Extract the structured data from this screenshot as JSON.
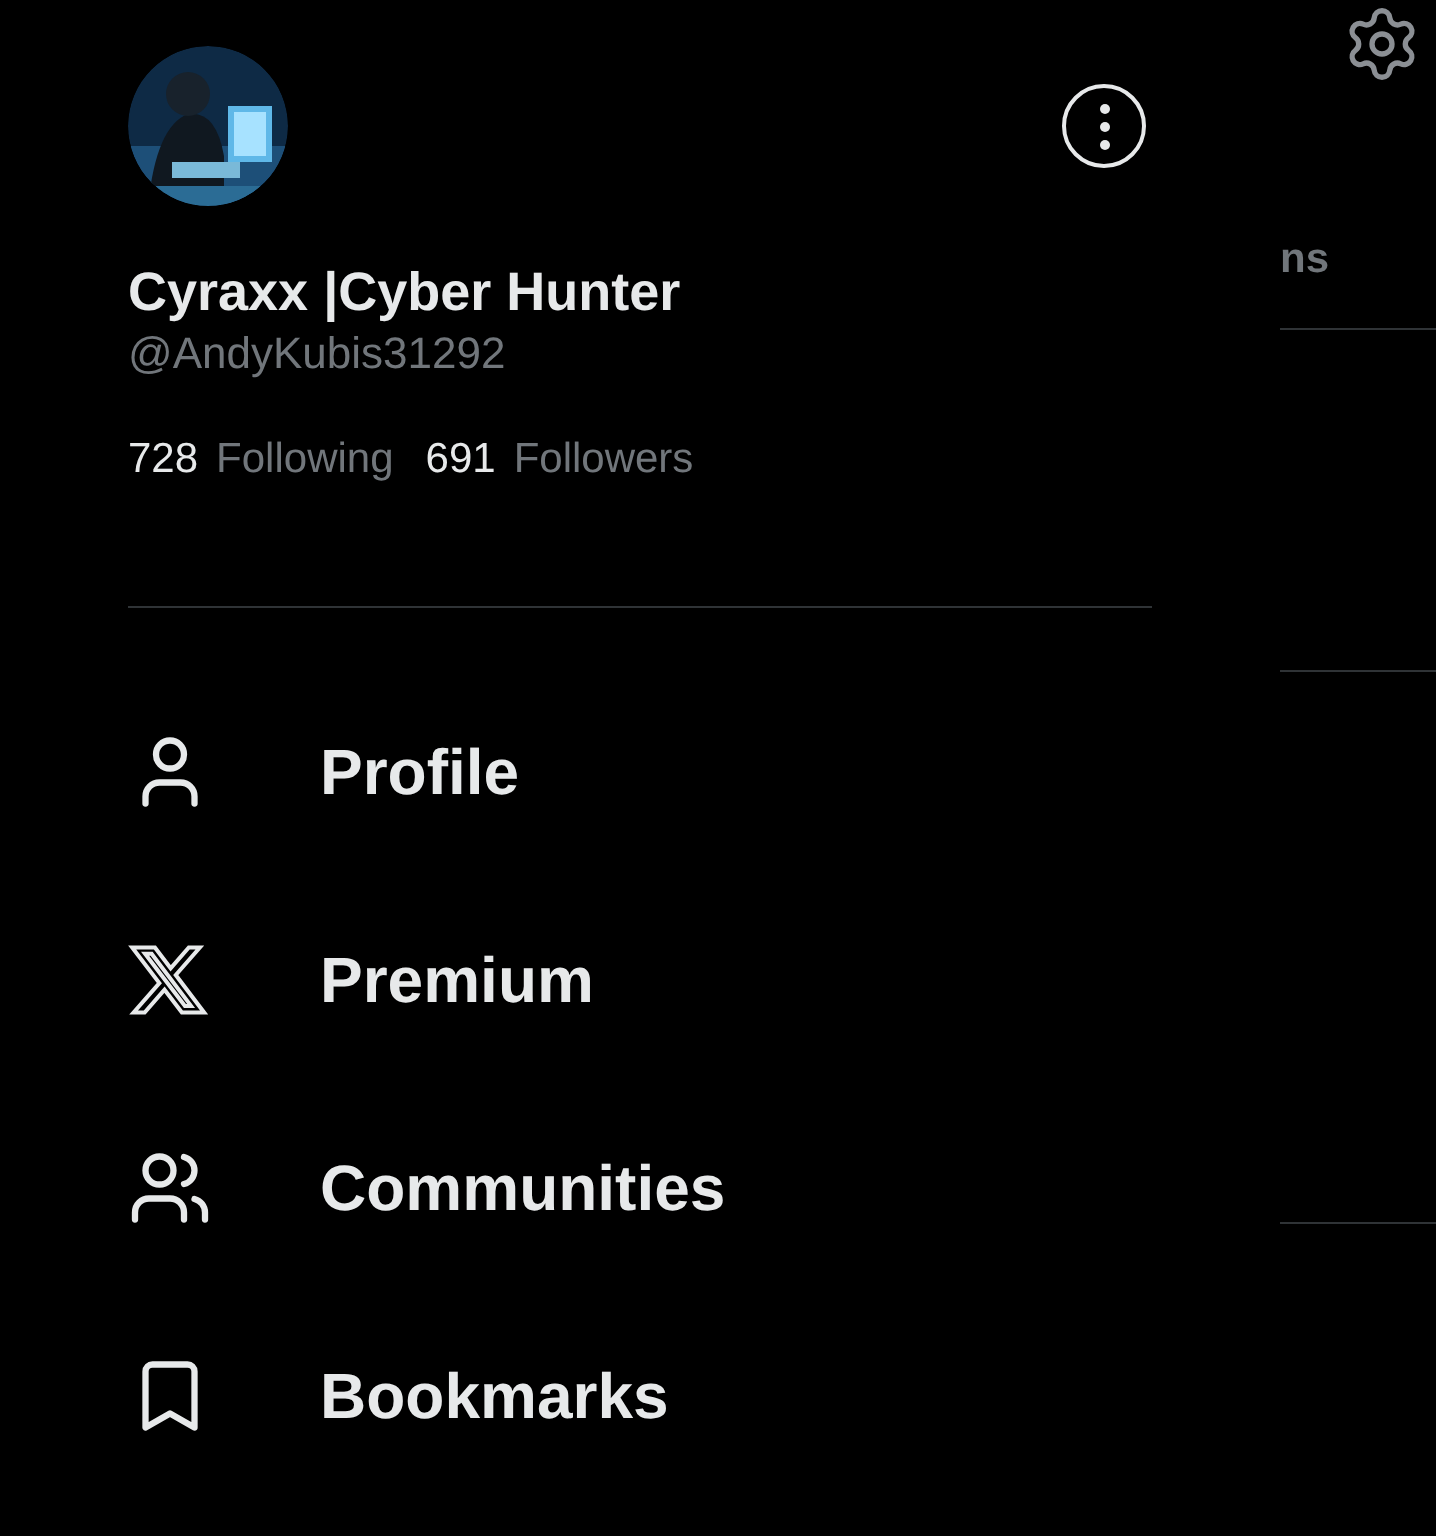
{
  "profile": {
    "name": "Cyraxx |Cyber Hunter",
    "handle": "@AndyKubis31292",
    "following_count": "728",
    "following_label": "Following",
    "followers_count": "691",
    "followers_label": "Followers"
  },
  "menu": [
    {
      "kind": "profile",
      "label": "Profile"
    },
    {
      "kind": "premium",
      "label": "Premium"
    },
    {
      "kind": "communities",
      "label": "Communities"
    },
    {
      "kind": "bookmarks",
      "label": "Bookmarks"
    }
  ],
  "background": {
    "tab_label": "ns"
  }
}
